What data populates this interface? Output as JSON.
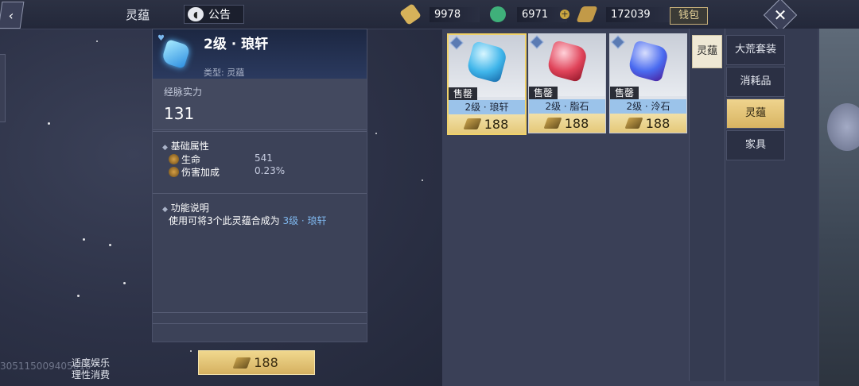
{
  "topbar": {
    "title": "灵蕴",
    "notice_label": "公告",
    "currencies": [
      {
        "icon": "gold-token-icon",
        "value": "9978",
        "color": "#d6b25a"
      },
      {
        "icon": "jade-coin-icon",
        "value": "6971",
        "color": "#3fb07a"
      },
      {
        "icon": "feather-coin-icon",
        "value": "172039",
        "color": "#c29a48"
      }
    ],
    "wallet_label": "钱包"
  },
  "detail": {
    "name": "2级 · 琅轩",
    "type_label": "类型: 灵蕴",
    "power_label": "经脉实力",
    "power_value": "131",
    "base_section": "基础属性",
    "attributes": [
      {
        "name": "生命",
        "value": "541"
      },
      {
        "name": "伤害加成",
        "value": "0.23%"
      }
    ],
    "func_section": "功能说明",
    "func_text_prefix": "使用可将3个此灵蕴合成为 ",
    "func_text_highlight": "3级 · 琅轩"
  },
  "buy_price": "188",
  "footer": {
    "uid": "305115009405610",
    "health_line1": "适度娱乐",
    "health_line2": "理性消费"
  },
  "items": [
    {
      "tag": "售罄",
      "name": "2级 · 琅轩",
      "price": "188",
      "gem_color": "#3fb5ea",
      "selected": true
    },
    {
      "tag": "售罄",
      "name": "2级 · 脂石",
      "price": "188",
      "gem_color": "#e0445a",
      "selected": false
    },
    {
      "tag": "售罄",
      "name": "2级 · 泠石",
      "price": "188",
      "gem_color": "#4a6bf0",
      "selected": false
    }
  ],
  "subcategory": "灵蕴",
  "categories": [
    {
      "label": "大荒套装",
      "active": false
    },
    {
      "label": "消耗品",
      "active": false
    },
    {
      "label": "灵蕴",
      "active": true
    },
    {
      "label": "家具",
      "active": false
    }
  ]
}
